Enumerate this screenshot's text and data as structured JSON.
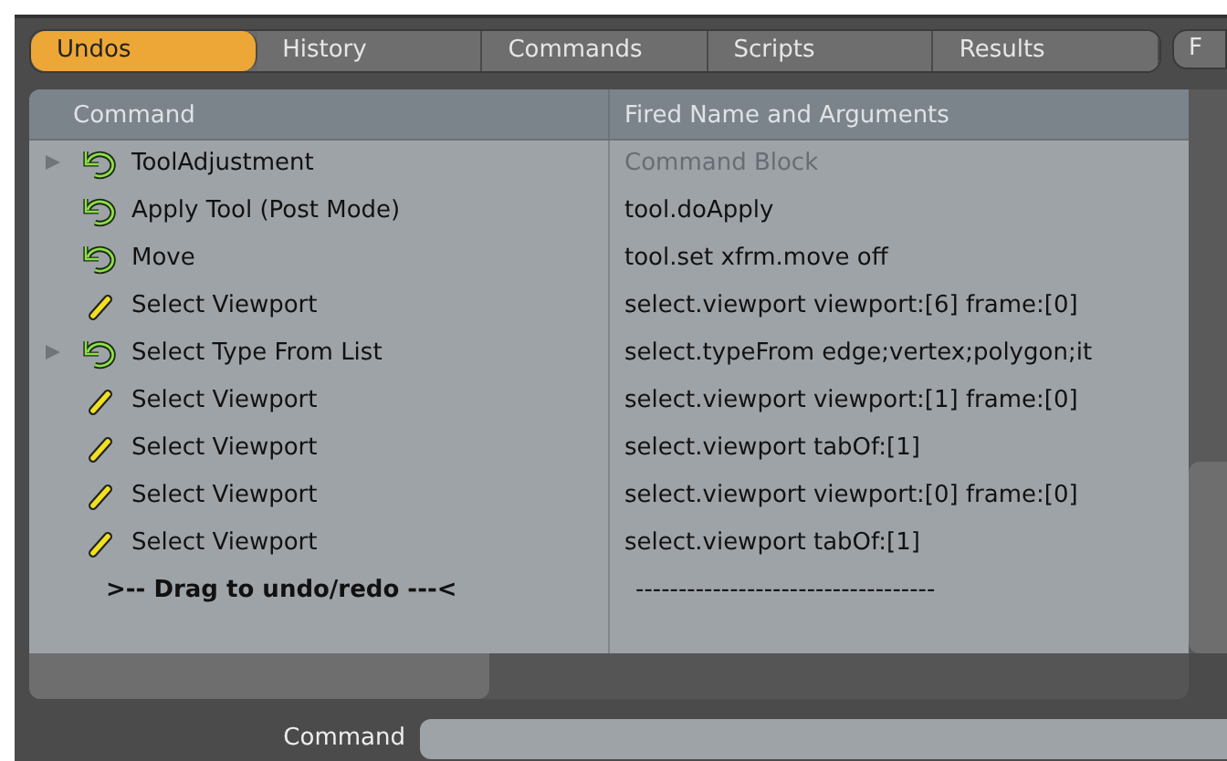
{
  "tabs": [
    {
      "label": "Undos",
      "selected": true
    },
    {
      "label": "History",
      "selected": false
    },
    {
      "label": "Commands",
      "selected": false
    },
    {
      "label": "Scripts",
      "selected": false
    },
    {
      "label": "Results",
      "selected": false
    },
    {
      "label": "F",
      "selected": false,
      "kind": "separate"
    }
  ],
  "table": {
    "columns": [
      "Command",
      "Fired Name and Arguments"
    ],
    "rows": [
      {
        "kind": "command",
        "expandable": true,
        "command": "ToolAdjustment",
        "fired": "Command Block",
        "dimmed": true
      },
      {
        "kind": "command",
        "expandable": false,
        "command": "Apply Tool (Post Mode)",
        "fired": "tool.doApply",
        "dimmed": false
      },
      {
        "kind": "command",
        "expandable": false,
        "command": "Move",
        "fired": "tool.set xfrm.move off",
        "dimmed": false
      },
      {
        "kind": "selection",
        "expandable": false,
        "command": "Select Viewport",
        "fired": "select.viewport viewport:[6] frame:[0]",
        "dimmed": false
      },
      {
        "kind": "command",
        "expandable": true,
        "command": "Select Type From List",
        "fired": "select.typeFrom edge;vertex;polygon;it",
        "dimmed": false
      },
      {
        "kind": "selection",
        "expandable": false,
        "command": "Select Viewport",
        "fired": "select.viewport viewport:[1] frame:[0]",
        "dimmed": false
      },
      {
        "kind": "selection",
        "expandable": false,
        "command": "Select Viewport",
        "fired": "select.viewport tabOf:[1]",
        "dimmed": false
      },
      {
        "kind": "selection",
        "expandable": false,
        "command": "Select Viewport",
        "fired": "select.viewport viewport:[0] frame:[0]",
        "dimmed": false
      },
      {
        "kind": "selection",
        "expandable": false,
        "command": "Select Viewport",
        "fired": "select.viewport tabOf:[1]",
        "dimmed": false
      },
      {
        "kind": "marker",
        "expandable": false,
        "command": ">-- Drag to undo/redo ---<",
        "fired": "-----------------------------------",
        "dimmed": false
      }
    ]
  },
  "command_bar": {
    "label": "Command"
  }
}
